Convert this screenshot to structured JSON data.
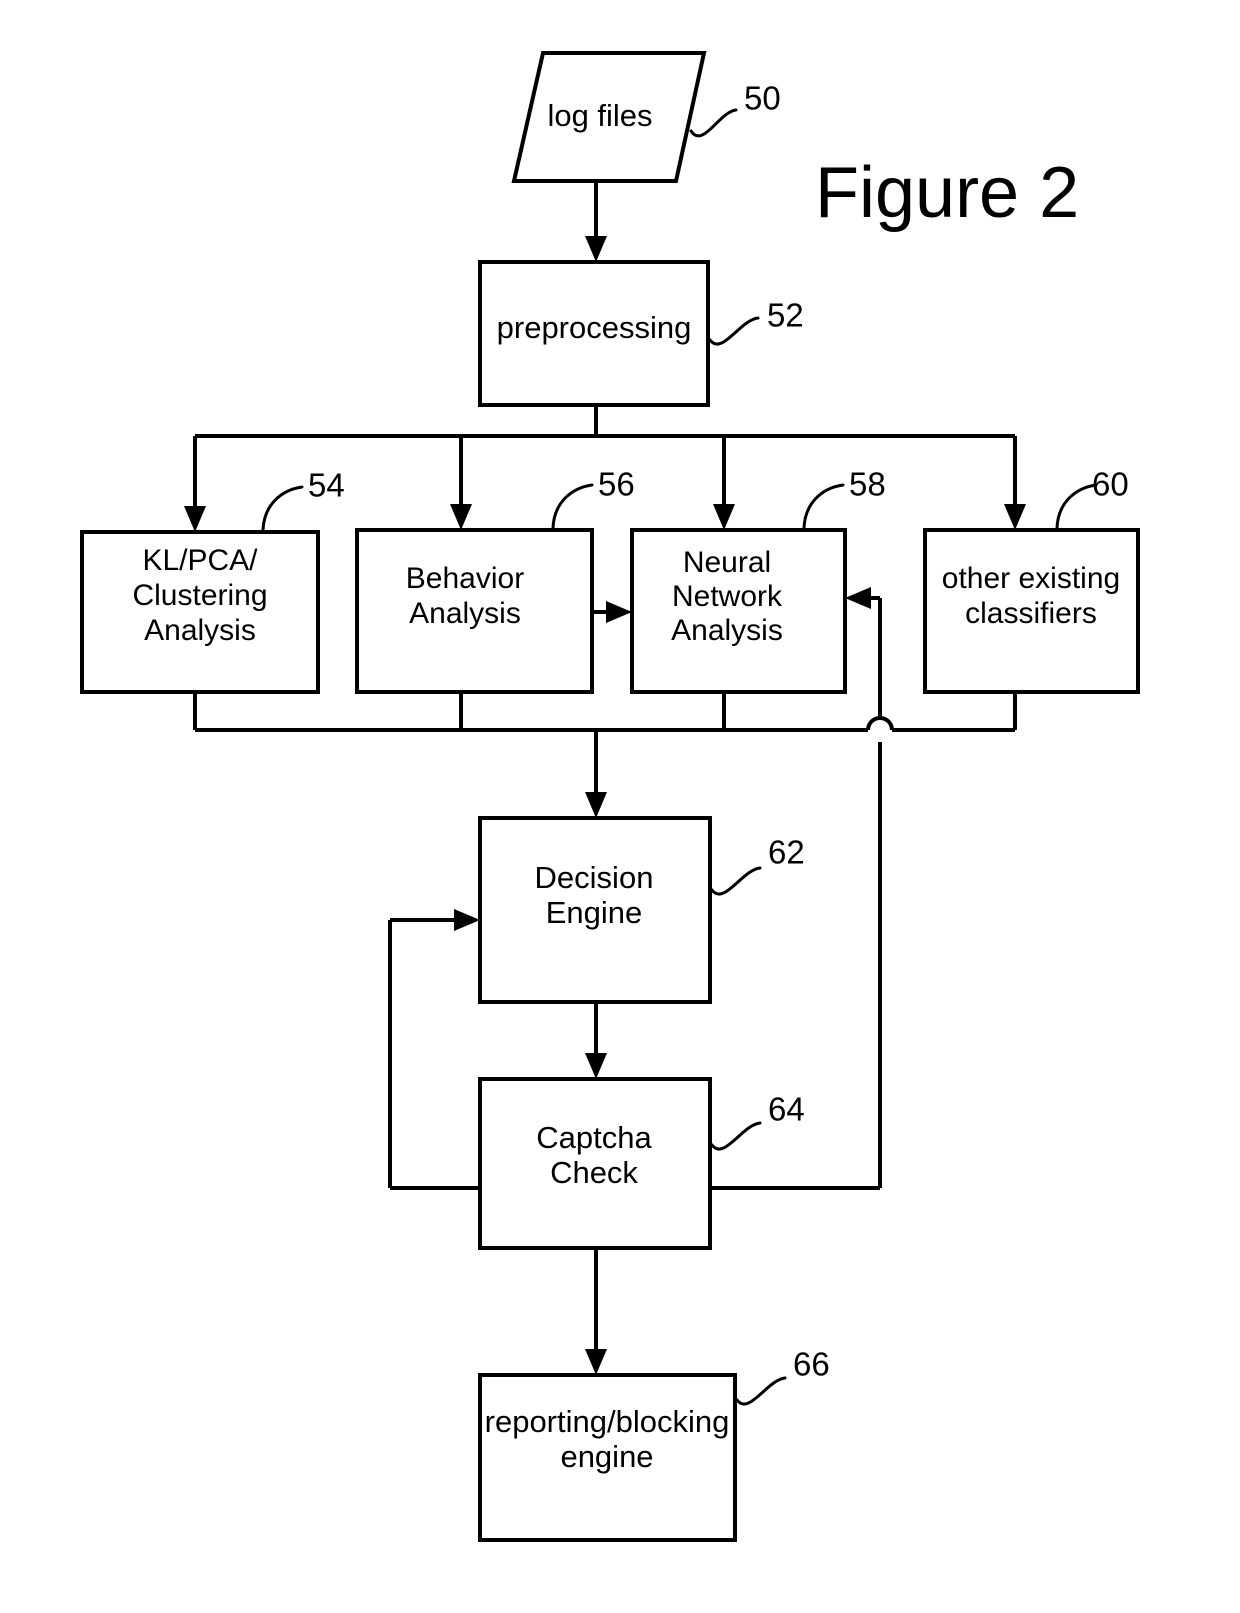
{
  "figure": {
    "title": "Figure 2"
  },
  "nodes": [
    {
      "id": "log-files",
      "shape": "parallelogram",
      "ref": "50",
      "lines": [
        "log files"
      ]
    },
    {
      "id": "preprocessing",
      "shape": "rectangle",
      "ref": "52",
      "lines": [
        "preprocessing"
      ]
    },
    {
      "id": "kl-pca-clustering-analysis",
      "shape": "rectangle",
      "ref": "54",
      "lines": [
        "KL/PCA/",
        "Clustering",
        "Analysis"
      ]
    },
    {
      "id": "behavior-analysis",
      "shape": "rectangle",
      "ref": "56",
      "lines": [
        "Behavior",
        "Analysis"
      ]
    },
    {
      "id": "neural-network-analysis",
      "shape": "rectangle",
      "ref": "58",
      "lines": [
        "Neural",
        "Network",
        "Analysis"
      ]
    },
    {
      "id": "other-existing-classifiers",
      "shape": "rectangle",
      "ref": "60",
      "lines": [
        "other existing",
        "classifiers"
      ]
    },
    {
      "id": "decision-engine",
      "shape": "rectangle",
      "ref": "62",
      "lines": [
        "Decision",
        "Engine"
      ]
    },
    {
      "id": "captcha-check",
      "shape": "rectangle",
      "ref": "64",
      "lines": [
        "Captcha",
        "Check"
      ]
    },
    {
      "id": "reporting-blocking-engine",
      "shape": "rectangle",
      "ref": "66",
      "lines": [
        "reporting/blocking",
        "engine"
      ]
    }
  ],
  "connections": [
    {
      "from": "log-files",
      "to": "preprocessing",
      "kind": "arrow-down"
    },
    {
      "from": "preprocessing",
      "to": "kl-pca-clustering-analysis",
      "kind": "bus-fanout"
    },
    {
      "from": "preprocessing",
      "to": "behavior-analysis",
      "kind": "bus-fanout"
    },
    {
      "from": "preprocessing",
      "to": "neural-network-analysis",
      "kind": "bus-fanout"
    },
    {
      "from": "preprocessing",
      "to": "other-existing-classifiers",
      "kind": "bus-fanout"
    },
    {
      "from": "behavior-analysis",
      "to": "neural-network-analysis",
      "kind": "arrow-right"
    },
    {
      "from": "kl-pca-clustering-analysis",
      "to": "decision-engine",
      "kind": "bus-merge"
    },
    {
      "from": "behavior-analysis",
      "to": "decision-engine",
      "kind": "bus-merge"
    },
    {
      "from": "neural-network-analysis",
      "to": "decision-engine",
      "kind": "bus-merge"
    },
    {
      "from": "other-existing-classifiers",
      "to": "decision-engine",
      "kind": "bus-merge"
    },
    {
      "from": "decision-engine",
      "to": "captcha-check",
      "kind": "arrow-down"
    },
    {
      "from": "captcha-check",
      "to": "decision-engine",
      "kind": "feedback-left"
    },
    {
      "from": "captcha-check",
      "to": "neural-network-analysis",
      "kind": "feedback-right"
    },
    {
      "from": "captcha-check",
      "to": "reporting-blocking-engine",
      "kind": "arrow-down"
    }
  ],
  "colors": {
    "stroke": "#000000",
    "fill": "#ffffff",
    "background": "#ffffff"
  }
}
